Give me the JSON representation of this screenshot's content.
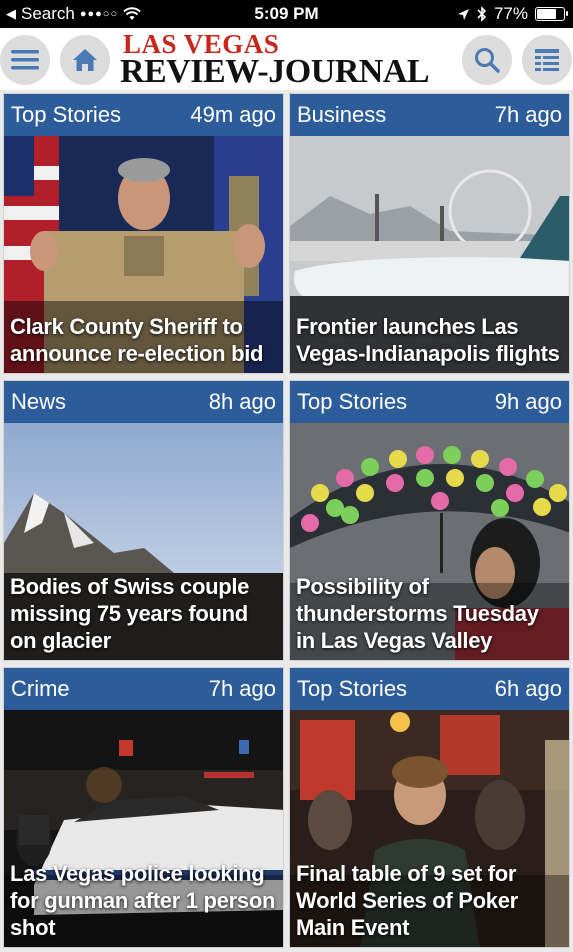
{
  "status_bar": {
    "back_label": "Search",
    "signal": "●●●○○",
    "time": "5:09 PM",
    "battery_text": "77%",
    "battery_level": 0.77
  },
  "header": {
    "logo_top": "LAS VEGAS",
    "logo_bottom": "REVIEW-JOURNAL",
    "accent_color": "#c8261c",
    "button_icons": [
      "hamburger-menu-icon",
      "home-icon",
      "search-icon",
      "section-list-icon"
    ]
  },
  "bar_color": "#2d5c9a",
  "cards": [
    {
      "section": "Top Stories",
      "time": "49m ago",
      "title": "Clark County Sheriff to announce re-election bid"
    },
    {
      "section": "Business",
      "time": "7h ago",
      "title": "Frontier launches Las Vegas-Indianapolis flights"
    },
    {
      "section": "News",
      "time": "8h ago",
      "title": "Bodies of Swiss couple missing 75 years found on glacier"
    },
    {
      "section": "Top Stories",
      "time": "9h ago",
      "title": "Possibility of thunderstorms Tuesday in Las Vegas Valley"
    },
    {
      "section": "Crime",
      "time": "7h ago",
      "title": "Las Vegas police looking for gunman after 1 person shot"
    },
    {
      "section": "Top Stories",
      "time": "6h ago",
      "title": "Final table of 9 set for World Series of Poker Main Event"
    }
  ]
}
